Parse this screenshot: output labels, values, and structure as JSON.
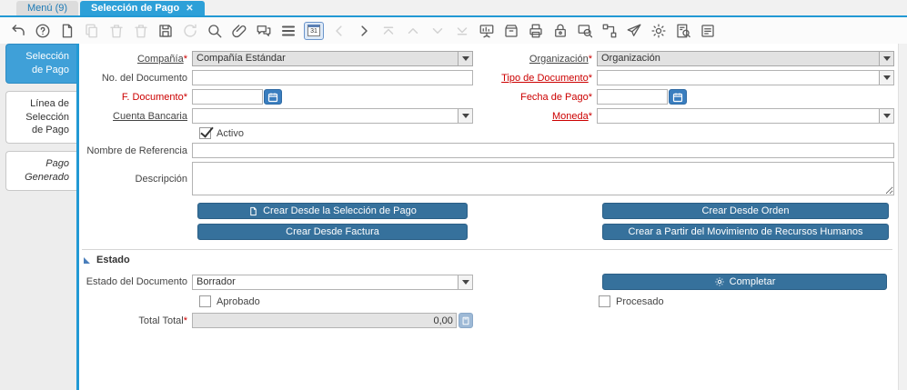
{
  "ui": {
    "required_mark": "*"
  },
  "tabbar": {
    "menu_tab": "Menú (9)",
    "active_tab": "Selección de Pago",
    "close_glyph": "✕"
  },
  "toolbar": {
    "calendar_label": "31",
    "icons": [
      {
        "name": "undo-icon",
        "enabled": true
      },
      {
        "name": "help-icon",
        "enabled": true
      },
      {
        "name": "new-record-icon",
        "enabled": true
      },
      {
        "name": "copy-record-icon",
        "enabled": false
      },
      {
        "name": "delete-record-icon",
        "enabled": false
      },
      {
        "name": "delete-selection-icon",
        "enabled": false
      },
      {
        "name": "save-icon",
        "enabled": true
      },
      {
        "name": "refresh-icon",
        "enabled": false
      },
      {
        "name": "find-icon",
        "enabled": true
      },
      {
        "name": "attachment-icon",
        "enabled": true
      },
      {
        "name": "chat-icon",
        "enabled": true
      },
      {
        "name": "grid-toggle-icon",
        "enabled": true
      },
      {
        "name": "calendar-icon",
        "enabled": true,
        "toggled": true
      },
      {
        "name": "previous-record-icon",
        "enabled": false
      },
      {
        "name": "next-record-icon",
        "enabled": true
      },
      {
        "name": "first-record-icon",
        "enabled": false
      },
      {
        "name": "parent-record-icon",
        "enabled": false
      },
      {
        "name": "detail-record-icon",
        "enabled": false
      },
      {
        "name": "last-record-icon",
        "enabled": false
      },
      {
        "name": "report-icon",
        "enabled": true
      },
      {
        "name": "archive-icon",
        "enabled": true
      },
      {
        "name": "print-icon",
        "enabled": true
      },
      {
        "name": "lock-icon",
        "enabled": true
      },
      {
        "name": "zoom-across-icon",
        "enabled": true
      },
      {
        "name": "workflow-icon",
        "enabled": true
      },
      {
        "name": "send-icon",
        "enabled": true
      },
      {
        "name": "preference-icon",
        "enabled": true
      },
      {
        "name": "archive-viewer-icon",
        "enabled": true
      },
      {
        "name": "report-view-icon",
        "enabled": true
      }
    ]
  },
  "sidebar": {
    "tabs": [
      {
        "label": "Selección de Pago",
        "active": true
      },
      {
        "label": "Línea de Selección de Pago",
        "active": false
      },
      {
        "label": "Pago Generado",
        "active": false,
        "italic": true
      }
    ]
  },
  "form": {
    "fields": {
      "compania": {
        "label": "Compañía",
        "value": "Compañía Estándar"
      },
      "organizacion": {
        "label": "Organización",
        "value": "Organización"
      },
      "no_documento": {
        "label": "No. del Documento",
        "value": ""
      },
      "tipo_documento": {
        "label": "Tipo de Documento",
        "value": ""
      },
      "f_documento": {
        "label": "F. Documento",
        "value": ""
      },
      "fecha_pago": {
        "label": "Fecha de Pago",
        "value": ""
      },
      "cuenta_bancaria": {
        "label": "Cuenta Bancaria",
        "value": ""
      },
      "moneda": {
        "label": "Moneda",
        "value": ""
      },
      "activo": {
        "label": "Activo",
        "checked": true
      },
      "nombre_referencia": {
        "label": "Nombre de Referencia",
        "value": ""
      },
      "descripcion": {
        "label": "Descripción",
        "value": ""
      }
    },
    "buttons": {
      "crear_seleccion": "Crear Desde la Selección de Pago",
      "crear_orden": "Crear Desde Orden",
      "crear_factura": "Crear Desde Factura",
      "crear_rrhh": "Crear a Partir del Movimiento de Recursos Humanos"
    },
    "estado": {
      "header": "Estado",
      "estado_documento": {
        "label": "Estado del Documento",
        "value": "Borrador"
      },
      "completar_label": "Completar",
      "aprobado": {
        "label": "Aprobado",
        "checked": false
      },
      "procesado": {
        "label": "Procesado",
        "checked": false
      },
      "total": {
        "label": "Total Total",
        "value": "0,00"
      }
    }
  },
  "colors": {
    "accent_blue": "#2299d4",
    "active_tab_blue": "#3fa0d8",
    "button_blue": "#36719c",
    "required_red": "#cc0000",
    "date_button_blue": "#3a7ebf"
  }
}
